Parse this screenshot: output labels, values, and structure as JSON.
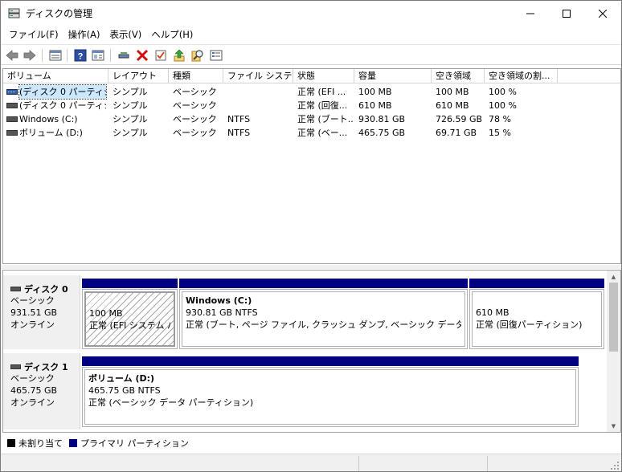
{
  "window": {
    "title": "ディスクの管理",
    "minimize_icon": "minimize-icon",
    "maximize_icon": "maximize-icon",
    "close_icon": "close-icon"
  },
  "menu": [
    "ファイル(F)",
    "操作(A)",
    "表示(V)",
    "ヘルプ(H)"
  ],
  "toolbar": [
    "back-arrow-icon",
    "forward-arrow-icon",
    "list-view-icon",
    "help-icon",
    "properties-icon",
    "connect-icon",
    "delete-icon",
    "check-icon",
    "upload-icon",
    "search-icon",
    "settings-icon"
  ],
  "columns": [
    "ボリューム",
    "レイアウト",
    "種類",
    "ファイル システム",
    "状態",
    "容量",
    "空き領域",
    "空き領域の割..."
  ],
  "volumes": [
    {
      "name": "(ディスク 0 パーティシ...",
      "layout": "シンプル",
      "type": "ベーシック",
      "fs": "",
      "status": "正常 (EFI ...",
      "capacity": "100 MB",
      "free": "100 MB",
      "pct": "100 %",
      "selected": true
    },
    {
      "name": "(ディスク 0 パーティシ...",
      "layout": "シンプル",
      "type": "ベーシック",
      "fs": "",
      "status": "正常 (回復...",
      "capacity": "610 MB",
      "free": "610 MB",
      "pct": "100 %",
      "selected": false
    },
    {
      "name": "Windows (C:)",
      "layout": "シンプル",
      "type": "ベーシック",
      "fs": "NTFS",
      "status": "正常 (ブート...",
      "capacity": "930.81 GB",
      "free": "726.59 GB",
      "pct": "78 %",
      "selected": false
    },
    {
      "name": "ボリューム (D:)",
      "layout": "シンプル",
      "type": "ベーシック",
      "fs": "NTFS",
      "status": "正常 (ベー...",
      "capacity": "465.75 GB",
      "free": "69.71 GB",
      "pct": "15 %",
      "selected": false
    }
  ],
  "disks": [
    {
      "name": "ディスク 0",
      "kind": "ベーシック",
      "size": "931.51 GB",
      "state": "オンライン",
      "partitions": [
        {
          "title": "",
          "size": "100 MB",
          "status": "正常 (EFI システム パー",
          "hatched": true
        },
        {
          "title": "Windows  (C:)",
          "size": "930.81 GB NTFS",
          "status": "正常 (ブート, ページ ファイル, クラッシュ ダンプ, ベーシック データ パーティショ",
          "hatched": false
        },
        {
          "title": "",
          "size": "610 MB",
          "status": "正常 (回復パーティション)",
          "hatched": false
        }
      ]
    },
    {
      "name": "ディスク 1",
      "kind": "ベーシック",
      "size": "465.75 GB",
      "state": "オンライン",
      "partitions": [
        {
          "title": "ボリューム  (D:)",
          "size": "465.75 GB NTFS",
          "status": "正常 (ベーシック データ パーティション)",
          "hatched": false
        }
      ]
    }
  ],
  "legend": [
    {
      "label": "未割り当て",
      "color": "#000000"
    },
    {
      "label": "プライマリ パーティション",
      "color": "#000080"
    }
  ],
  "colors": {
    "primary_partition": "#000080",
    "unallocated": "#000000",
    "selection": "#cce8ff"
  }
}
